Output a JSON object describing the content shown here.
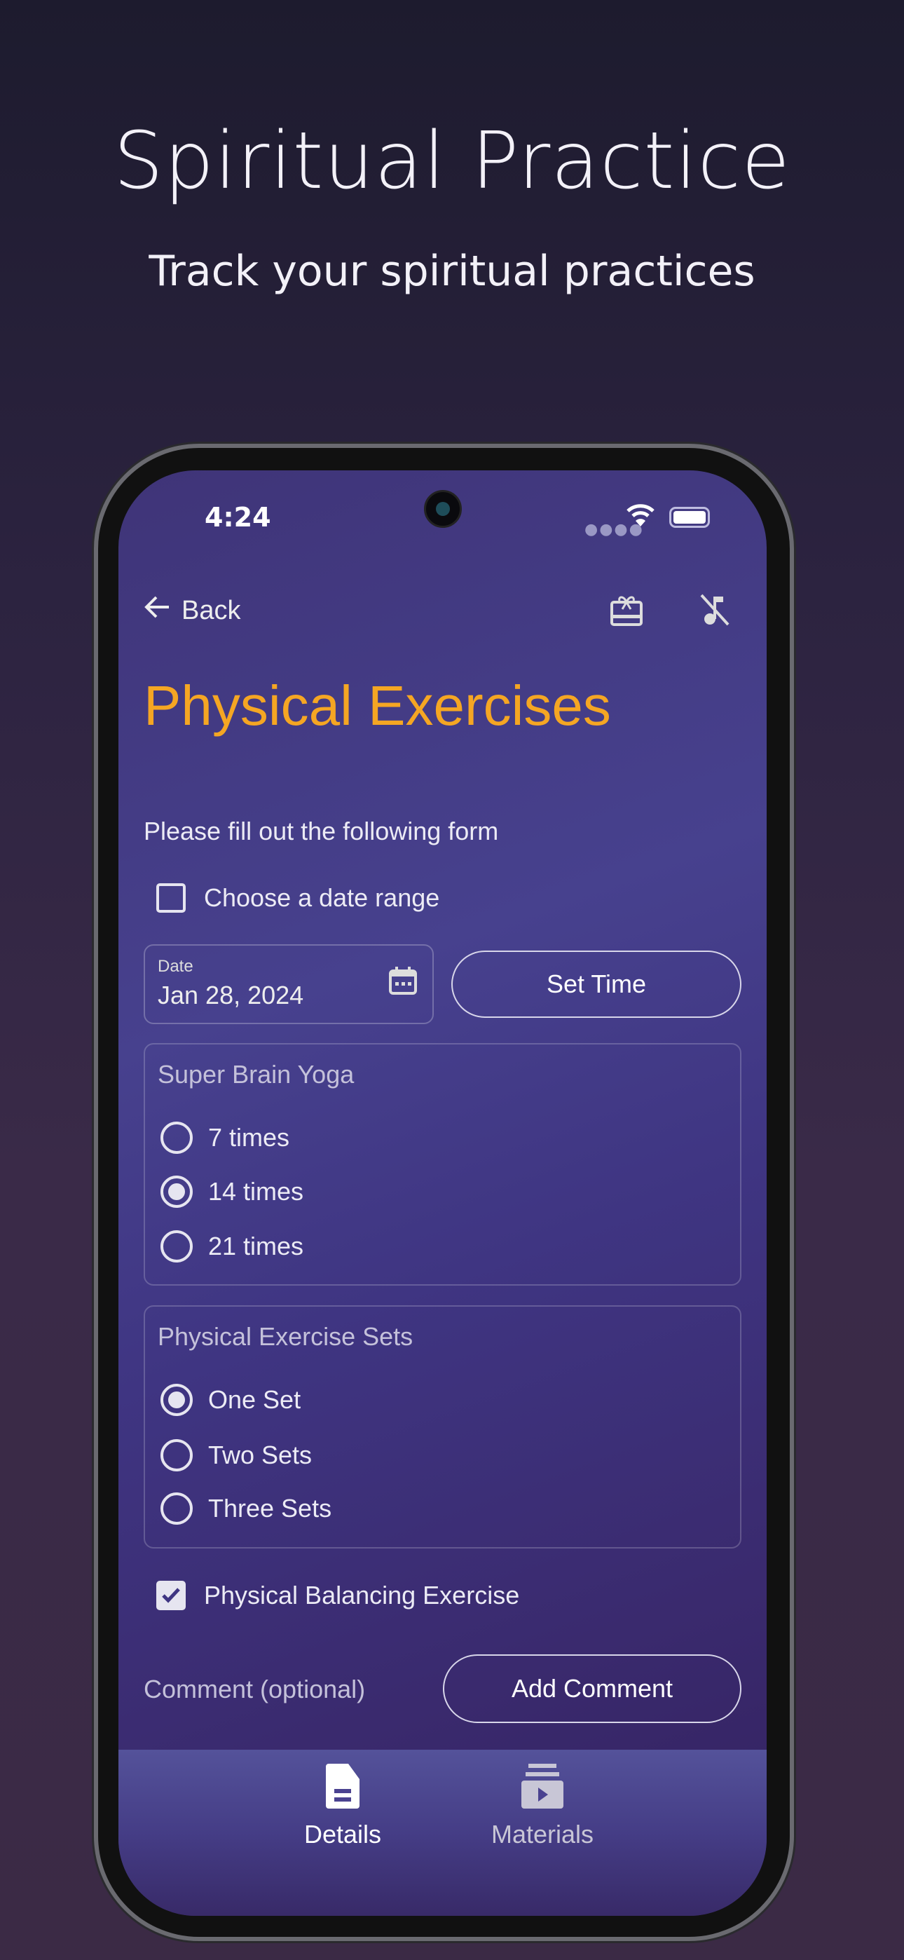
{
  "hero": {
    "title": "Spiritual Practice",
    "subtitle": "Track your spiritual practices"
  },
  "status_bar": {
    "time": "4:24",
    "signal_icon": "signal-dots",
    "wifi_icon": "wifi",
    "battery_icon": "battery-full"
  },
  "header": {
    "back_label": "Back",
    "back_icon": "arrow-left",
    "gift_icon": "gift-card",
    "music_off_icon": "music-off"
  },
  "page": {
    "title": "Physical Exercises",
    "title_color": "#f5a623",
    "instructions": "Please fill out the following form"
  },
  "form": {
    "date_range": {
      "label": "Choose a date range",
      "checked": false
    },
    "date": {
      "label": "Date",
      "value": "Jan 28, 2024",
      "icon": "calendar"
    },
    "set_time_label": "Set Time",
    "super_brain_yoga": {
      "label": "Super Brain Yoga",
      "options": [
        "7 times",
        "14 times",
        "21 times"
      ],
      "selected": "14 times"
    },
    "exercise_sets": {
      "label": "Physical Exercise Sets",
      "options": [
        "One Set",
        "Two Sets",
        "Three Sets"
      ],
      "selected": "One Set"
    },
    "balancing": {
      "label": "Physical Balancing Exercise",
      "checked": true
    },
    "comment_label": "Comment (optional)",
    "add_comment_label": "Add Comment"
  },
  "bottom_nav": {
    "tabs": [
      {
        "label": "Details",
        "icon": "document",
        "active": true
      },
      {
        "label": "Materials",
        "icon": "video-library",
        "active": false
      }
    ]
  }
}
